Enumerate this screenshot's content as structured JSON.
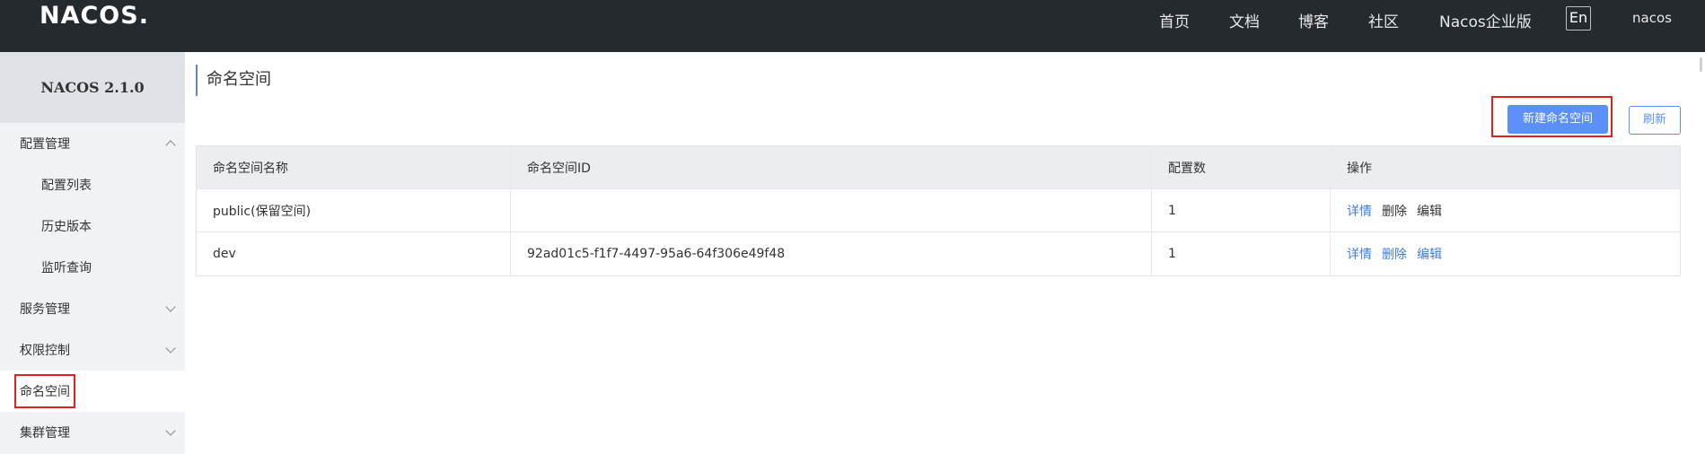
{
  "topbar": {
    "logo": "NACOS.",
    "nav": [
      "首页",
      "文档",
      "博客",
      "社区",
      "Nacos企业版"
    ],
    "lang": "En",
    "user": "nacos"
  },
  "sidebar": {
    "version": "NACOS 2.1.0",
    "items": [
      {
        "label": "配置管理",
        "type": "group",
        "expanded": true
      },
      {
        "label": "配置列表",
        "type": "sub"
      },
      {
        "label": "历史版本",
        "type": "sub"
      },
      {
        "label": "监听查询",
        "type": "sub"
      },
      {
        "label": "服务管理",
        "type": "group",
        "expanded": false
      },
      {
        "label": "权限控制",
        "type": "group",
        "expanded": false
      },
      {
        "label": "命名空间",
        "type": "item",
        "active": true
      },
      {
        "label": "集群管理",
        "type": "group",
        "expanded": false
      }
    ]
  },
  "main": {
    "title": "命名空间",
    "new_button": "新建命名空间",
    "refresh_button": "刷新",
    "table": {
      "headers": [
        "命名空间名称",
        "命名空间ID",
        "配置数",
        "操作"
      ],
      "rows": [
        {
          "name": "public(保留空间)",
          "id": "",
          "count": "1",
          "actions": [
            "详情",
            "删除",
            "编辑"
          ]
        },
        {
          "name": "dev",
          "id": "92ad01c5-f1f7-4497-95a6-64f306e49f48",
          "count": "1",
          "actions": [
            "详情",
            "删除",
            "编辑"
          ]
        }
      ]
    }
  },
  "colors": {
    "topbar": "#252a2f",
    "sidebar": "#f0f2f5",
    "primary": "#5b8ff9",
    "link": "#3f7bd6",
    "highlight": "#e02020"
  }
}
